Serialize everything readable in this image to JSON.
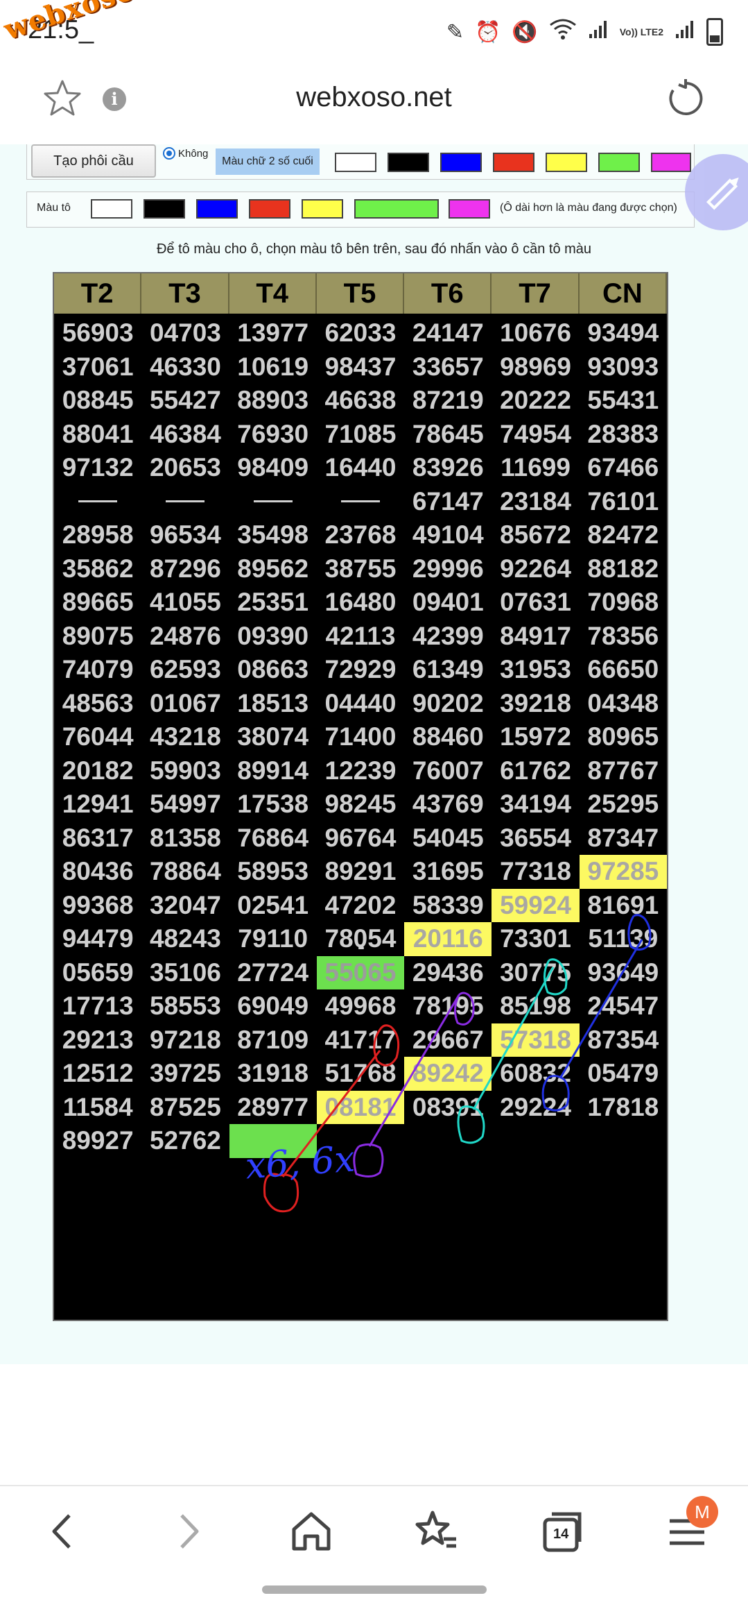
{
  "status": {
    "time": "21:5_",
    "network": "Vo)) LTE2"
  },
  "watermark": "webxoso.net",
  "browser": {
    "url": "webxoso.net",
    "tab_count": "14",
    "profile_initial": "M"
  },
  "toolbar": {
    "create_button": "Tạo phôi cầu",
    "radio_label": "Không",
    "last2_color_label": "Màu chữ 2 số cuối",
    "paint_color_label": "Màu tô",
    "note": "(Ô dài hơn là màu đang được chọn)",
    "swatch_colors": [
      "#ffffff",
      "#000000",
      "#0000ff",
      "#e8331e",
      "#ffff4a",
      "#6ff04a",
      "#ee33ee"
    ]
  },
  "instruction": "Để tô màu cho ô, chọn màu tô bên trên, sau đó nhấn vào ô cần tô màu",
  "table": {
    "headers": [
      "T2",
      "T3",
      "T4",
      "T5",
      "T6",
      "T7",
      "CN"
    ],
    "rows": [
      [
        "56903",
        "04703",
        "13977",
        "62033",
        "24147",
        "10676",
        "93494"
      ],
      [
        "37061",
        "46330",
        "10619",
        "98437",
        "33657",
        "98969",
        "93093"
      ],
      [
        "08845",
        "55427",
        "88903",
        "46638",
        "87219",
        "20222",
        "55431"
      ],
      [
        "88041",
        "46384",
        "76930",
        "71085",
        "78645",
        "74954",
        "28383"
      ],
      [
        "97132",
        "20653",
        "98409",
        "16440",
        "83926",
        "11699",
        "67466"
      ],
      [
        "—",
        "—",
        "—",
        "—",
        "67147",
        "23184",
        "76101"
      ],
      [
        "28958",
        "96534",
        "35498",
        "23768",
        "49104",
        "85672",
        "82472"
      ],
      [
        "35862",
        "87296",
        "89562",
        "38755",
        "29996",
        "92264",
        "88182"
      ],
      [
        "89665",
        "41055",
        "25351",
        "16480",
        "09401",
        "07631",
        "70968"
      ],
      [
        "89075",
        "24876",
        "09390",
        "42113",
        "42399",
        "84917",
        "78356"
      ],
      [
        "74079",
        "62593",
        "08663",
        "72929",
        "61349",
        "31953",
        "66650"
      ],
      [
        "48563",
        "01067",
        "18513",
        "04440",
        "90202",
        "39218",
        "04348"
      ],
      [
        "76044",
        "43218",
        "38074",
        "71400",
        "88460",
        "15972",
        "80965"
      ],
      [
        "20182",
        "59903",
        "89914",
        "12239",
        "76007",
        "61762",
        "87767"
      ],
      [
        "12941",
        "54997",
        "17538",
        "98245",
        "43769",
        "34194",
        "25295"
      ],
      [
        "86317",
        "81358",
        "76864",
        "96764",
        "54045",
        "36554",
        "87347"
      ],
      [
        "80436",
        "78864",
        "58953",
        "89291",
        "31695",
        "77318",
        "97285"
      ],
      [
        "99368",
        "32047",
        "02541",
        "47202",
        "58339",
        "59924",
        "81691"
      ],
      [
        "94479",
        "48243",
        "79110",
        "78054",
        "20116",
        "73301",
        "51139"
      ],
      [
        "05659",
        "35106",
        "27724",
        "55065",
        "29436",
        "30775",
        "93649"
      ],
      [
        "17713",
        "58553",
        "69049",
        "49968",
        "78195",
        "85198",
        "24547"
      ],
      [
        "29213",
        "97218",
        "87109",
        "41717",
        "29667",
        "57318",
        "87354"
      ],
      [
        "12512",
        "39725",
        "31918",
        "51768",
        "89242",
        "60832",
        "05479"
      ],
      [
        "11584",
        "87525",
        "28977",
        "08181",
        "08391",
        "29224",
        "17818"
      ],
      [
        "89927",
        "52762",
        "",
        "",
        "",
        "",
        ""
      ]
    ],
    "highlights": {
      "16-6": "y",
      "17-5": "y",
      "18-4": "y",
      "19-3": "g",
      "21-5": "y",
      "22-4": "y",
      "23-3": "y",
      "24-2": "g"
    },
    "extra_dash": "-",
    "handwritten_note": "x6, 6x"
  }
}
